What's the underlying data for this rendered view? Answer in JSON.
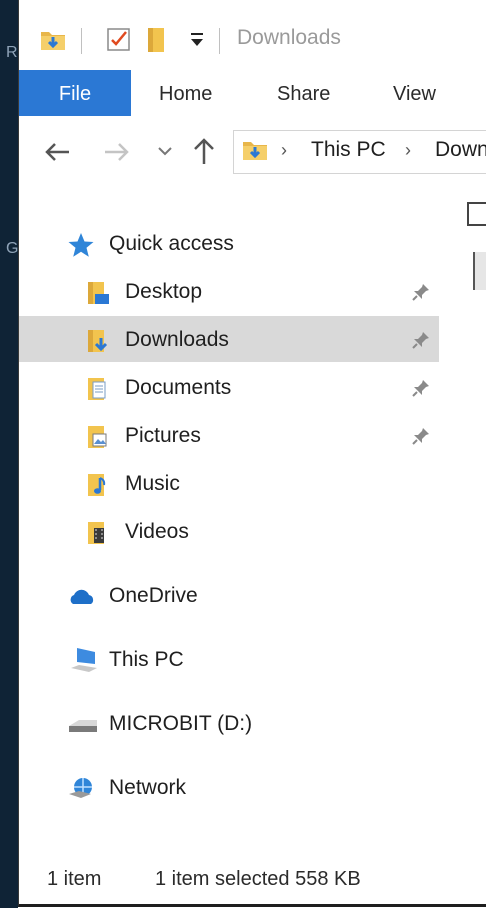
{
  "window": {
    "title": "Downloads"
  },
  "desktop": {
    "edge_letters": [
      "R",
      "G"
    ]
  },
  "ribbon": {
    "tabs": [
      "File",
      "Home",
      "Share",
      "View"
    ],
    "active_color": "#2b78d4"
  },
  "address": {
    "crumbs": [
      "This PC",
      "Downl"
    ]
  },
  "nav": {
    "quick_access": "Quick access",
    "pinned": [
      {
        "label": "Desktop",
        "icon": "desktop-folder-icon",
        "pinned": true
      },
      {
        "label": "Downloads",
        "icon": "downloads-folder-icon",
        "pinned": true,
        "selected": true
      },
      {
        "label": "Documents",
        "icon": "documents-folder-icon",
        "pinned": true
      },
      {
        "label": "Pictures",
        "icon": "pictures-folder-icon",
        "pinned": true
      },
      {
        "label": "Music",
        "icon": "music-folder-icon",
        "pinned": false
      },
      {
        "label": "Videos",
        "icon": "videos-folder-icon",
        "pinned": false
      }
    ],
    "onedrive": "OneDrive",
    "this_pc": "This PC",
    "drive": "MICROBIT (D:)",
    "network": "Network"
  },
  "status": {
    "count": "1 item",
    "selection": "1 item selected  558 KB"
  }
}
